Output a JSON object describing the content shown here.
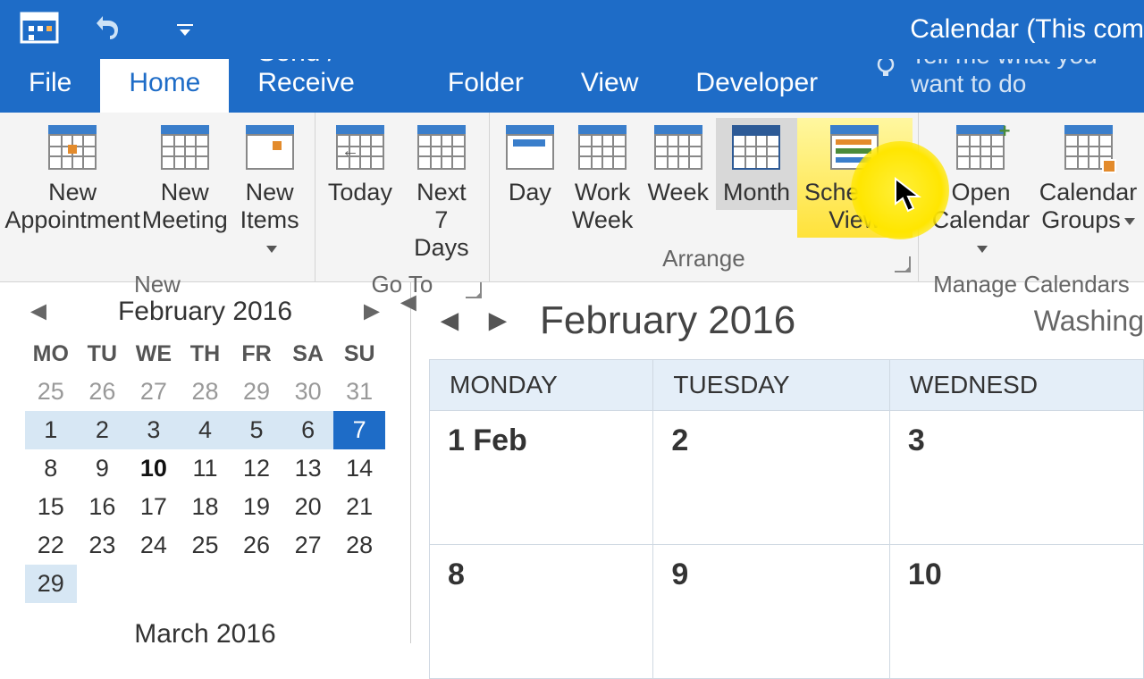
{
  "titlebar": {
    "title": "Calendar (This com"
  },
  "tabs": {
    "file": "File",
    "home": "Home",
    "send_receive": "Send / Receive",
    "folder": "Folder",
    "view": "View",
    "developer": "Developer",
    "tell_me": "Tell me what you want to do"
  },
  "ribbon": {
    "new": {
      "label": "New",
      "appointment": "New\nAppointment",
      "meeting": "New\nMeeting",
      "items": "New\nItems"
    },
    "goto": {
      "label": "Go To",
      "today": "Today",
      "next7": "Next 7\nDays"
    },
    "arrange": {
      "label": "Arrange",
      "day": "Day",
      "work_week": "Work\nWeek",
      "week": "Week",
      "month": "Month",
      "schedule": "Schedule\nView"
    },
    "manage": {
      "label": "Manage Calendars",
      "open_calendar": "Open\nCalendar",
      "calendar_groups": "Calendar\nGroups"
    }
  },
  "mini": {
    "month_label": "February 2016",
    "next_month_label": "March 2016",
    "dow": [
      "MO",
      "TU",
      "WE",
      "TH",
      "FR",
      "SA",
      "SU"
    ],
    "weeks": [
      [
        {
          "n": "25",
          "o": true
        },
        {
          "n": "26",
          "o": true
        },
        {
          "n": "27",
          "o": true
        },
        {
          "n": "28",
          "o": true
        },
        {
          "n": "29",
          "o": true
        },
        {
          "n": "30",
          "o": true
        },
        {
          "n": "31",
          "o": true
        }
      ],
      [
        {
          "n": "1",
          "r": true
        },
        {
          "n": "2",
          "r": true
        },
        {
          "n": "3",
          "r": true
        },
        {
          "n": "4",
          "r": true
        },
        {
          "n": "5",
          "r": true
        },
        {
          "n": "6",
          "r": true
        },
        {
          "n": "7",
          "sel": true
        }
      ],
      [
        {
          "n": "8"
        },
        {
          "n": "9"
        },
        {
          "n": "10",
          "t": true
        },
        {
          "n": "11"
        },
        {
          "n": "12"
        },
        {
          "n": "13"
        },
        {
          "n": "14"
        }
      ],
      [
        {
          "n": "15"
        },
        {
          "n": "16"
        },
        {
          "n": "17"
        },
        {
          "n": "18"
        },
        {
          "n": "19"
        },
        {
          "n": "20"
        },
        {
          "n": "21"
        }
      ],
      [
        {
          "n": "22"
        },
        {
          "n": "23"
        },
        {
          "n": "24"
        },
        {
          "n": "25"
        },
        {
          "n": "26"
        },
        {
          "n": "27"
        },
        {
          "n": "28"
        }
      ],
      [
        {
          "n": "29",
          "r": true
        },
        {
          "n": ""
        },
        {
          "n": ""
        },
        {
          "n": ""
        },
        {
          "n": ""
        },
        {
          "n": ""
        },
        {
          "n": ""
        }
      ]
    ]
  },
  "main": {
    "title": "February 2016",
    "location": "Washing",
    "columns": [
      "MONDAY",
      "TUESDAY",
      "WEDNESD"
    ],
    "rows": [
      [
        {
          "d": "1 Feb",
          "first": true
        },
        {
          "d": "2"
        },
        {
          "d": "3"
        }
      ],
      [
        {
          "d": "8"
        },
        {
          "d": "9"
        },
        {
          "d": "10"
        }
      ]
    ]
  }
}
